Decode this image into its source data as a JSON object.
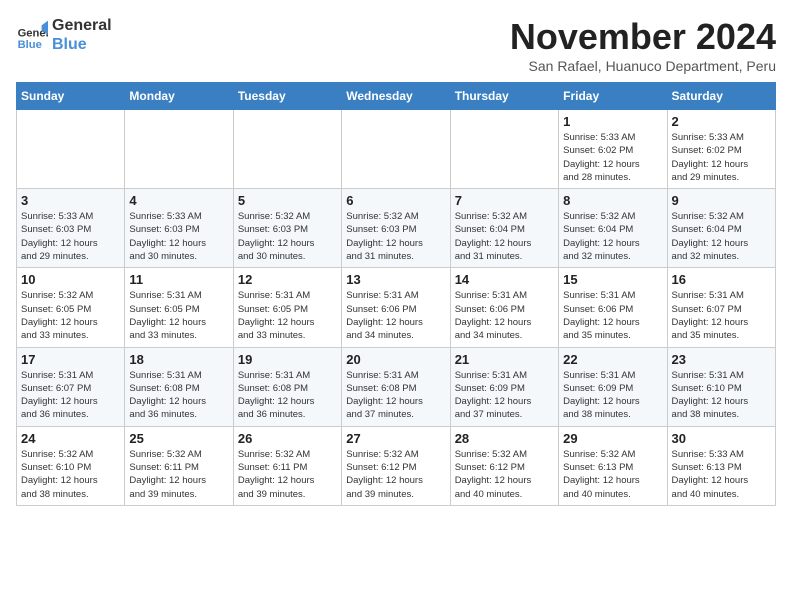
{
  "logo": {
    "line1": "General",
    "line2": "Blue"
  },
  "title": "November 2024",
  "subtitle": "San Rafael, Huanuco Department, Peru",
  "weekdays": [
    "Sunday",
    "Monday",
    "Tuesday",
    "Wednesday",
    "Thursday",
    "Friday",
    "Saturday"
  ],
  "weeks": [
    [
      {
        "day": "",
        "info": ""
      },
      {
        "day": "",
        "info": ""
      },
      {
        "day": "",
        "info": ""
      },
      {
        "day": "",
        "info": ""
      },
      {
        "day": "",
        "info": ""
      },
      {
        "day": "1",
        "info": "Sunrise: 5:33 AM\nSunset: 6:02 PM\nDaylight: 12 hours\nand 28 minutes."
      },
      {
        "day": "2",
        "info": "Sunrise: 5:33 AM\nSunset: 6:02 PM\nDaylight: 12 hours\nand 29 minutes."
      }
    ],
    [
      {
        "day": "3",
        "info": "Sunrise: 5:33 AM\nSunset: 6:03 PM\nDaylight: 12 hours\nand 29 minutes."
      },
      {
        "day": "4",
        "info": "Sunrise: 5:33 AM\nSunset: 6:03 PM\nDaylight: 12 hours\nand 30 minutes."
      },
      {
        "day": "5",
        "info": "Sunrise: 5:32 AM\nSunset: 6:03 PM\nDaylight: 12 hours\nand 30 minutes."
      },
      {
        "day": "6",
        "info": "Sunrise: 5:32 AM\nSunset: 6:03 PM\nDaylight: 12 hours\nand 31 minutes."
      },
      {
        "day": "7",
        "info": "Sunrise: 5:32 AM\nSunset: 6:04 PM\nDaylight: 12 hours\nand 31 minutes."
      },
      {
        "day": "8",
        "info": "Sunrise: 5:32 AM\nSunset: 6:04 PM\nDaylight: 12 hours\nand 32 minutes."
      },
      {
        "day": "9",
        "info": "Sunrise: 5:32 AM\nSunset: 6:04 PM\nDaylight: 12 hours\nand 32 minutes."
      }
    ],
    [
      {
        "day": "10",
        "info": "Sunrise: 5:32 AM\nSunset: 6:05 PM\nDaylight: 12 hours\nand 33 minutes."
      },
      {
        "day": "11",
        "info": "Sunrise: 5:31 AM\nSunset: 6:05 PM\nDaylight: 12 hours\nand 33 minutes."
      },
      {
        "day": "12",
        "info": "Sunrise: 5:31 AM\nSunset: 6:05 PM\nDaylight: 12 hours\nand 33 minutes."
      },
      {
        "day": "13",
        "info": "Sunrise: 5:31 AM\nSunset: 6:06 PM\nDaylight: 12 hours\nand 34 minutes."
      },
      {
        "day": "14",
        "info": "Sunrise: 5:31 AM\nSunset: 6:06 PM\nDaylight: 12 hours\nand 34 minutes."
      },
      {
        "day": "15",
        "info": "Sunrise: 5:31 AM\nSunset: 6:06 PM\nDaylight: 12 hours\nand 35 minutes."
      },
      {
        "day": "16",
        "info": "Sunrise: 5:31 AM\nSunset: 6:07 PM\nDaylight: 12 hours\nand 35 minutes."
      }
    ],
    [
      {
        "day": "17",
        "info": "Sunrise: 5:31 AM\nSunset: 6:07 PM\nDaylight: 12 hours\nand 36 minutes."
      },
      {
        "day": "18",
        "info": "Sunrise: 5:31 AM\nSunset: 6:08 PM\nDaylight: 12 hours\nand 36 minutes."
      },
      {
        "day": "19",
        "info": "Sunrise: 5:31 AM\nSunset: 6:08 PM\nDaylight: 12 hours\nand 36 minutes."
      },
      {
        "day": "20",
        "info": "Sunrise: 5:31 AM\nSunset: 6:08 PM\nDaylight: 12 hours\nand 37 minutes."
      },
      {
        "day": "21",
        "info": "Sunrise: 5:31 AM\nSunset: 6:09 PM\nDaylight: 12 hours\nand 37 minutes."
      },
      {
        "day": "22",
        "info": "Sunrise: 5:31 AM\nSunset: 6:09 PM\nDaylight: 12 hours\nand 38 minutes."
      },
      {
        "day": "23",
        "info": "Sunrise: 5:31 AM\nSunset: 6:10 PM\nDaylight: 12 hours\nand 38 minutes."
      }
    ],
    [
      {
        "day": "24",
        "info": "Sunrise: 5:32 AM\nSunset: 6:10 PM\nDaylight: 12 hours\nand 38 minutes."
      },
      {
        "day": "25",
        "info": "Sunrise: 5:32 AM\nSunset: 6:11 PM\nDaylight: 12 hours\nand 39 minutes."
      },
      {
        "day": "26",
        "info": "Sunrise: 5:32 AM\nSunset: 6:11 PM\nDaylight: 12 hours\nand 39 minutes."
      },
      {
        "day": "27",
        "info": "Sunrise: 5:32 AM\nSunset: 6:12 PM\nDaylight: 12 hours\nand 39 minutes."
      },
      {
        "day": "28",
        "info": "Sunrise: 5:32 AM\nSunset: 6:12 PM\nDaylight: 12 hours\nand 40 minutes."
      },
      {
        "day": "29",
        "info": "Sunrise: 5:32 AM\nSunset: 6:13 PM\nDaylight: 12 hours\nand 40 minutes."
      },
      {
        "day": "30",
        "info": "Sunrise: 5:33 AM\nSunset: 6:13 PM\nDaylight: 12 hours\nand 40 minutes."
      }
    ]
  ]
}
